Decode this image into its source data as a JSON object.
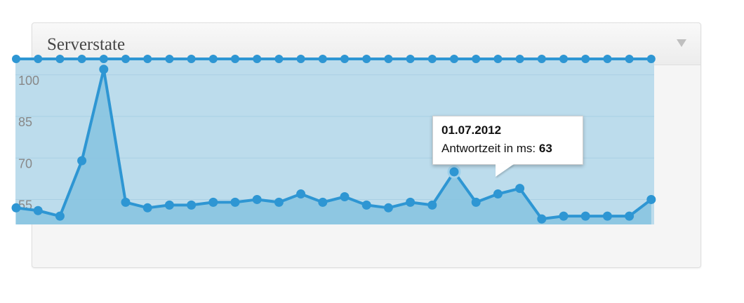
{
  "widget": {
    "title": "Serverstate"
  },
  "tooltip": {
    "date": "01.07.2012",
    "label": "Antwortzeit in ms:",
    "value": "63"
  },
  "colors": {
    "line": "#2e96d3",
    "area_bg": "#bcdcec",
    "area_fill": "#86c3e0",
    "tick_text": "#888888"
  },
  "chart_data": {
    "type": "area",
    "y_ticks": [
      100,
      85,
      70,
      55
    ],
    "ylim": [
      44,
      104
    ],
    "grid": true,
    "series": [
      {
        "values": [
          50,
          49,
          47,
          67,
          100,
          52,
          50,
          51,
          51,
          52,
          52,
          53,
          52,
          55,
          52,
          54,
          51,
          50,
          52,
          51,
          63,
          52,
          55,
          57,
          46,
          47,
          47,
          47,
          47,
          53
        ]
      }
    ],
    "top_series_value": 104,
    "highlight_index": 20
  }
}
